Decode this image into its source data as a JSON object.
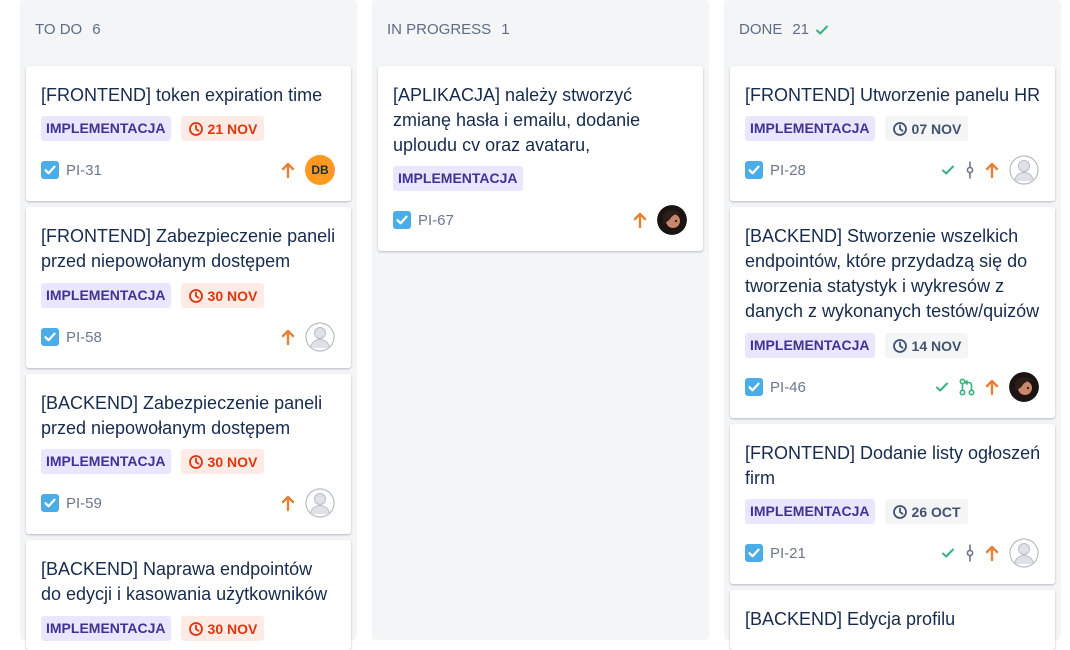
{
  "columns": [
    {
      "title": "TO DO",
      "count": "6",
      "cards": [
        {
          "title": "[FRONTEND] token expiration time",
          "epic": "IMPLEMENTACJA",
          "due": "21 NOV",
          "key": "PI-31",
          "avatar": "DB"
        },
        {
          "title": "[FRONTEND] Zabezpieczenie paneli przed niepowołanym dostępem",
          "epic": "IMPLEMENTACJA",
          "due": "30 NOV",
          "key": "PI-58"
        },
        {
          "title": "[BACKEND] Zabezpieczenie paneli przed niepowołanym dostępem",
          "epic": "IMPLEMENTACJA",
          "due": "30 NOV",
          "key": "PI-59"
        },
        {
          "title": "[BACKEND] Naprawa endpointów do edycji i kasowania użytkowników",
          "epic": "IMPLEMENTACJA",
          "due": "30 NOV"
        }
      ]
    },
    {
      "title": "IN PROGRESS",
      "count": "1",
      "cards": [
        {
          "title": "[APLIKACJA] należy stworzyć zmianę hasła i emailu, dodanie uploudu cv oraz avataru,",
          "epic": "IMPLEMENTACJA",
          "key": "PI-67"
        }
      ]
    },
    {
      "title": "DONE",
      "count": "21",
      "cards": [
        {
          "title": "[FRONTEND] Utworzenie panelu HR",
          "epic": "IMPLEMENTACJA",
          "due": "07 NOV",
          "key": "PI-28"
        },
        {
          "title": "[BACKEND] Stworzenie wszelkich endpointów, które przydadzą się do tworzenia statystyk i wykresów z danych z wykonanych testów/quizów",
          "epic": "IMPLEMENTACJA",
          "due": "14 NOV",
          "key": "PI-46"
        },
        {
          "title": "[FRONTEND] Dodanie listy ogłoszeń firm",
          "epic": "IMPLEMENTACJA",
          "due": "26 OCT",
          "key": "PI-21"
        },
        {
          "title": "[BACKEND] Edycja profilu"
        }
      ]
    }
  ],
  "icons": {
    "task": "checkbox-icon",
    "priority": "arrow-up-icon",
    "done": "checkmark-icon",
    "commit": "commit-icon",
    "pull_request": "pull-request-icon",
    "due": "clock-icon"
  },
  "colors": {
    "epic_bg": "#eae6ff",
    "epic_text": "#403294",
    "overdue_bg": "#ffebe6",
    "overdue_text": "#de350b",
    "task_blue": "#4bade8",
    "priority_orange": "#e97f33",
    "done_green": "#36b37e"
  }
}
